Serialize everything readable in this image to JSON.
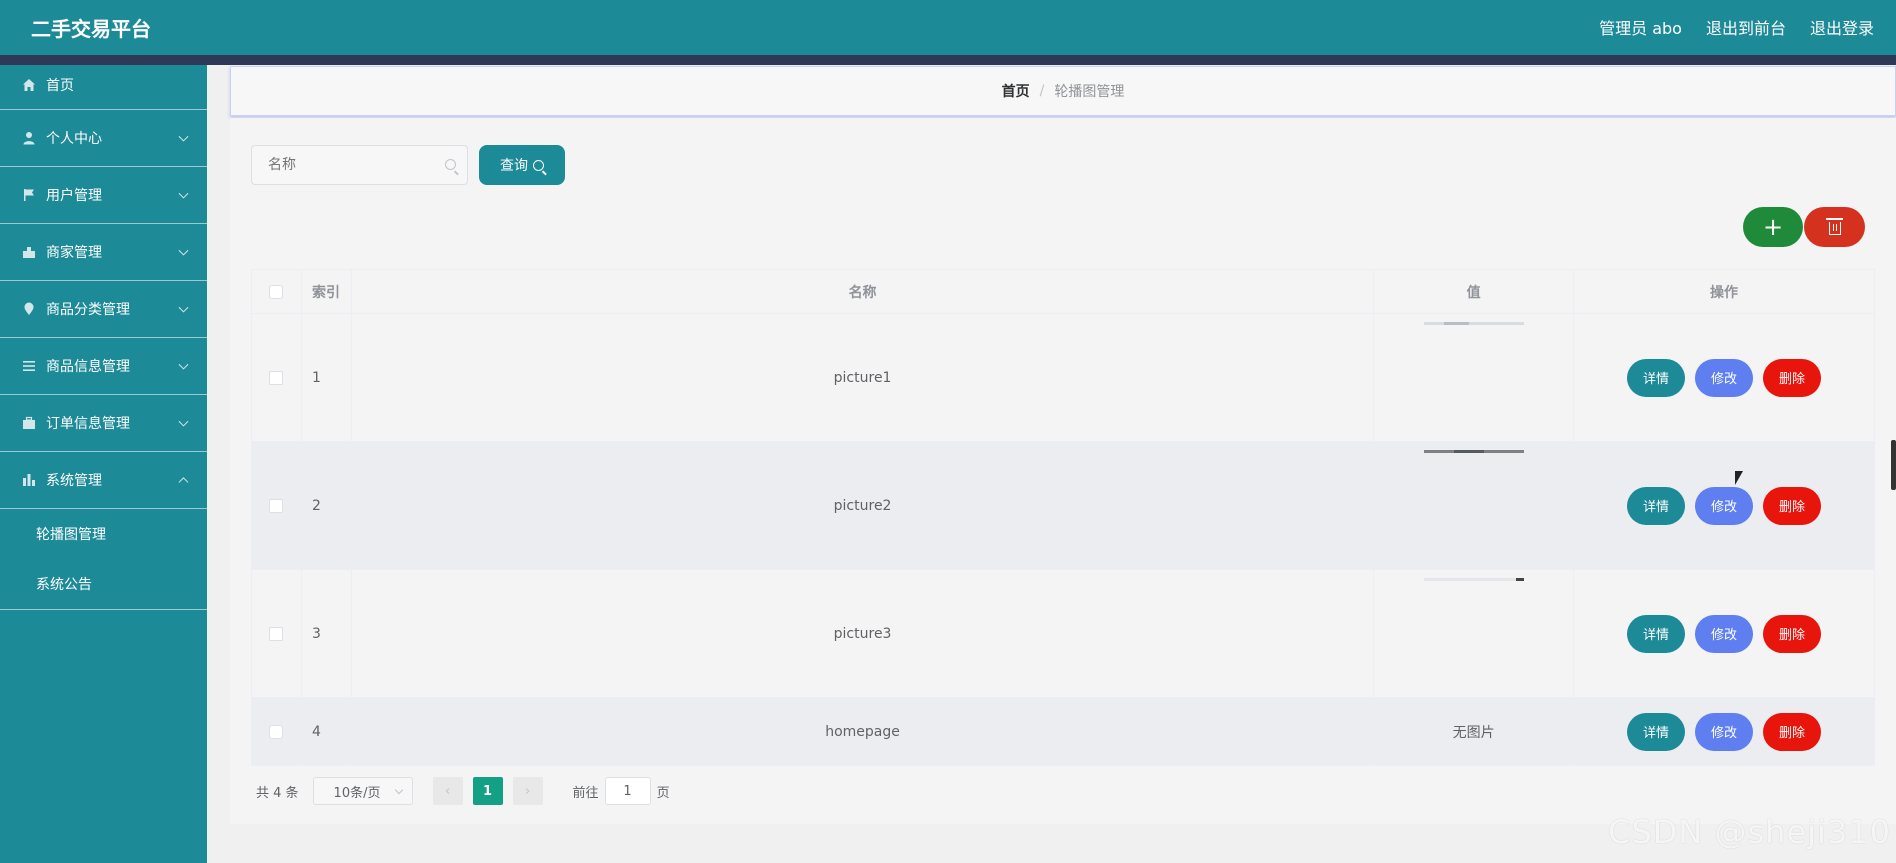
{
  "header": {
    "app_title": "二手交易平台",
    "admin_label": "管理员 abo",
    "exit_front": "退出到前台",
    "logout": "退出登录"
  },
  "sidebar": {
    "items": [
      {
        "label": "首页",
        "icon": "home-icon"
      },
      {
        "label": "个人中心",
        "icon": "user-icon"
      },
      {
        "label": "用户管理",
        "icon": "flag-icon"
      },
      {
        "label": "商家管理",
        "icon": "shop-icon"
      },
      {
        "label": "商品分类管理",
        "icon": "location-icon"
      },
      {
        "label": "商品信息管理",
        "icon": "menu-icon"
      },
      {
        "label": "订单信息管理",
        "icon": "briefcase-icon"
      },
      {
        "label": "系统管理",
        "icon": "chart-icon"
      }
    ],
    "sub_items": [
      "轮播图管理",
      "系统公告"
    ]
  },
  "breadcrumb": {
    "home": "首页",
    "separator": "/",
    "current": "轮播图管理"
  },
  "search": {
    "placeholder": "名称",
    "query_label": "查询"
  },
  "actions": {
    "add_symbol": "+"
  },
  "table": {
    "headers": {
      "index": "索引",
      "name": "名称",
      "value": "值",
      "operation": "操作"
    },
    "rows": [
      {
        "index": "1",
        "name": "picture1",
        "value": ""
      },
      {
        "index": "2",
        "name": "picture2",
        "value": ""
      },
      {
        "index": "3",
        "name": "picture3",
        "value": ""
      },
      {
        "index": "4",
        "name": "homepage",
        "value": "无图片"
      }
    ],
    "op_labels": {
      "detail": "详情",
      "edit": "修改",
      "delete": "删除"
    }
  },
  "pagination": {
    "total": "共 4 条",
    "page_size": "10条/页",
    "current_page": "1",
    "goto_label": "前往",
    "goto_value": "1",
    "page_unit": "页",
    "prev_symbol": "‹",
    "next_symbol": "›"
  },
  "watermark": "CSDN @sheji310",
  "colors": {
    "primary": "#1d8a98",
    "add": "#1e8a3a",
    "delete": "#e8150c",
    "edit": "#5f7ff1",
    "page_active": "#14a085"
  }
}
